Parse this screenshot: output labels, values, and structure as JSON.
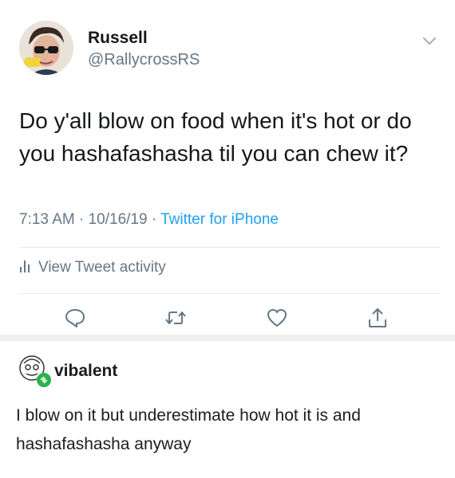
{
  "tweet": {
    "author": {
      "name": "Russell",
      "handle": "@RallycrossRS"
    },
    "text_line1": "Do y'all blow on food when it's hot or do",
    "text_line2": "you hashafashasha til you can chew it?",
    "time": "7:13 AM",
    "date": "10/16/19",
    "source": "Twitter for iPhone",
    "activity_label": "View Tweet activity",
    "icons": {
      "caret": "chevron-down-icon",
      "activity": "bar-chart-icon",
      "reply": "reply-icon",
      "retweet": "retweet-icon",
      "like": "heart-icon",
      "share": "share-icon"
    },
    "colors": {
      "link": "#1da1f2",
      "muted": "#657786",
      "text": "#14171a"
    }
  },
  "reply": {
    "username": "vibalent",
    "text_line1": "I blow on it but underestimate how hot it is and",
    "text_line2": "hashafashasha anyway",
    "badge_color": "#2bb24c"
  }
}
